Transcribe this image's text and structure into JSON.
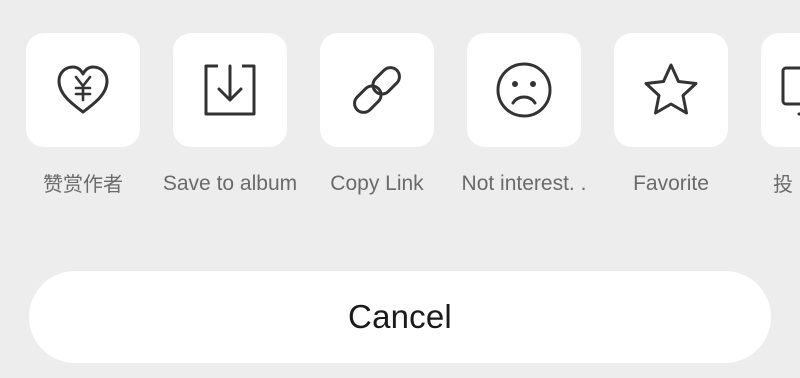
{
  "share_sheet": {
    "actions": [
      {
        "label": "赞赏作者",
        "icon": "heart-yen-icon"
      },
      {
        "label": "Save to album",
        "icon": "download-tray-icon"
      },
      {
        "label": "Copy Link",
        "icon": "link-icon"
      },
      {
        "label": "Not interest. .",
        "icon": "sad-face-icon"
      },
      {
        "label": "Favorite",
        "icon": "star-icon"
      },
      {
        "label": "投",
        "icon": "monitor-icon"
      }
    ],
    "cancel_label": "Cancel"
  },
  "colors": {
    "background": "#ededed",
    "tile": "#ffffff",
    "icon_stroke": "#333333",
    "label": "#6a6a6a",
    "cancel_text": "#1a1a1a"
  }
}
